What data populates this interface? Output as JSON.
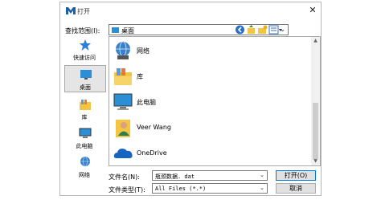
{
  "window": {
    "title": "打开"
  },
  "lookin": {
    "label": "查找范围(I):",
    "value": "桌面"
  },
  "places": [
    {
      "label": "快速访问",
      "icon": "star-icon"
    },
    {
      "label": "桌面",
      "icon": "desktop-icon",
      "selected": true
    },
    {
      "label": "库",
      "icon": "library-icon"
    },
    {
      "label": "此电脑",
      "icon": "computer-icon"
    },
    {
      "label": "网络",
      "icon": "network-icon"
    }
  ],
  "files": [
    {
      "name": "网络",
      "icon": "network-icon"
    },
    {
      "name": "库",
      "icon": "library-icon"
    },
    {
      "name": "此电脑",
      "icon": "computer-icon"
    },
    {
      "name": "Veer Wang",
      "icon": "user-folder-icon"
    },
    {
      "name": "OneDrive",
      "icon": "cloud-icon"
    }
  ],
  "filename": {
    "label": "文件名(N):",
    "value": "瓶颈数据. dat"
  },
  "filetype": {
    "label": "文件类型(T):",
    "value": "All Files (*.*)"
  },
  "buttons": {
    "open": "打开(O)",
    "cancel": "取消"
  },
  "colors": {
    "accent": "#0078d7",
    "folder": "#f4c542",
    "selection": "#e5e5e5"
  }
}
